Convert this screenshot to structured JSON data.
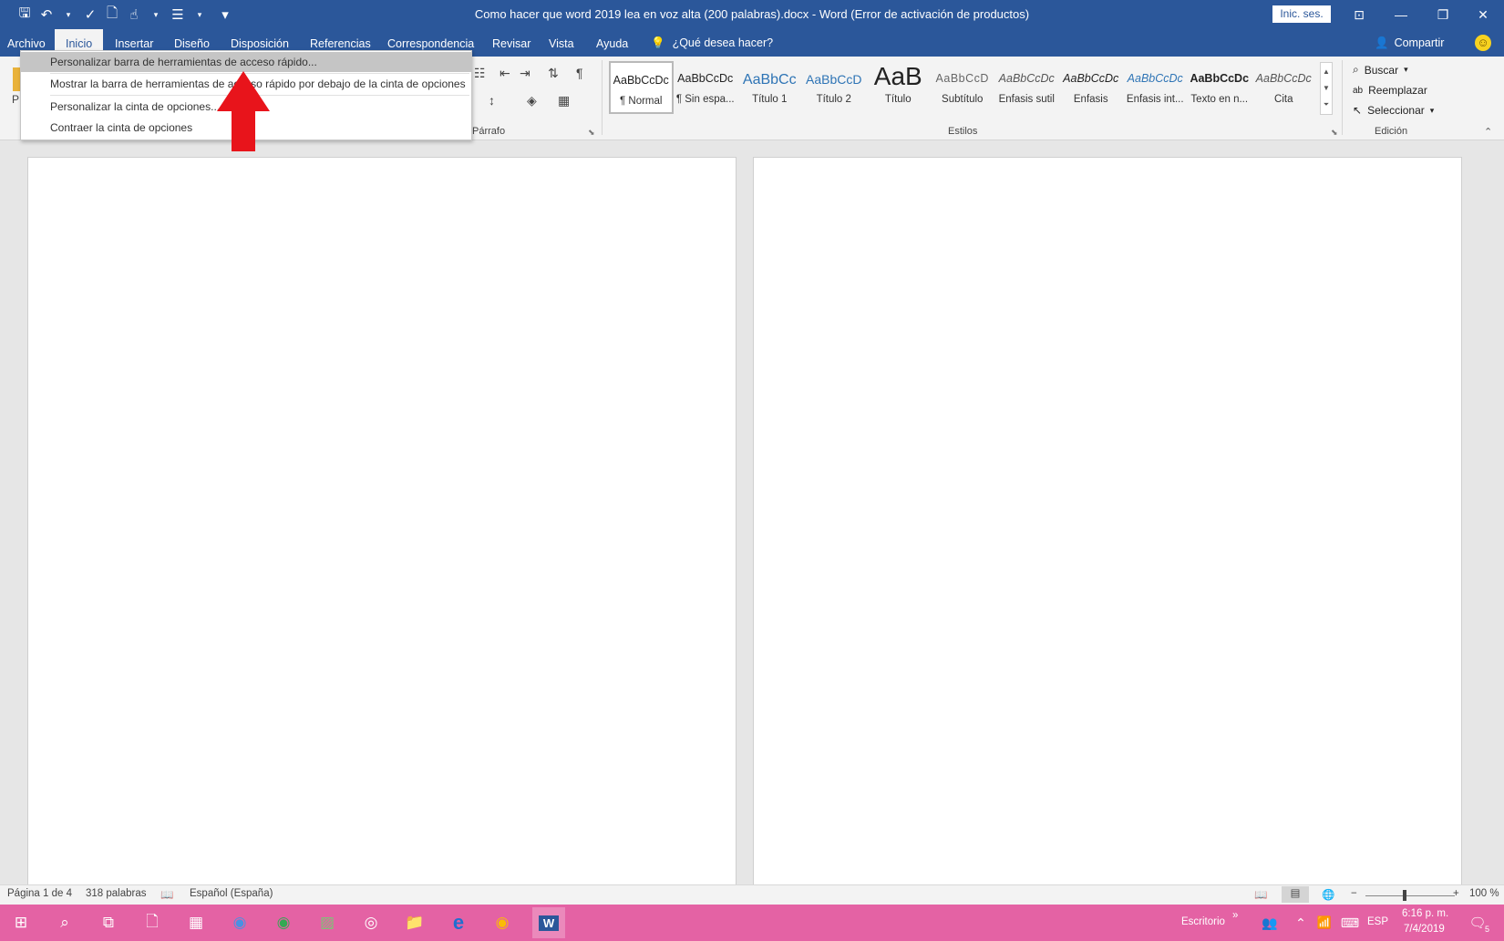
{
  "window": {
    "title": "Como hacer que word 2019 lea en voz alta (200 palabras).docx  -  Word (Error de activación de productos)",
    "signin": "Inic. ses.",
    "minimize": "—",
    "restore": "❐",
    "close": "✕",
    "ribbon_display": "⊡"
  },
  "qat": {
    "save": "🖫",
    "undo": "↶",
    "spell": "✓",
    "new": "🗋",
    "touch": "☝",
    "list": "☰",
    "more": "▾",
    "caret": "▾"
  },
  "tabs": [
    "Archivo",
    "Inicio",
    "Insertar",
    "Diseño",
    "Disposición",
    "Referencias",
    "Correspondencia",
    "Revisar",
    "Vista",
    "Ayuda"
  ],
  "tellme": {
    "label": "¿Qué desea hacer?",
    "icon": "💡"
  },
  "share": {
    "label": "Compartir",
    "icon": "👤"
  },
  "smiley": "☺",
  "context_menu": {
    "items": [
      "Personalizar barra de herramientas de acceso rápido...",
      "Mostrar la barra de herramientas de acceso rápido por debajo de la cinta de opciones",
      "Personalizar la cinta de opciones...",
      "Contraer la cinta de opciones"
    ]
  },
  "ribbon": {
    "clipboard_partial": "P",
    "paragraph_label": "Párrafo",
    "styles_label": "Estilos",
    "editing_label": "Edición",
    "paragraph_icons": {
      "list": "☷",
      "decrease_indent": "⇤",
      "increase_indent": "⇥",
      "sort": "⇅",
      "pilcrow": "¶",
      "line_spacing": "↕",
      "shading": "◈",
      "borders": "▦"
    },
    "styles": [
      {
        "sample": "AaBbCcDc",
        "name": "¶ Normal"
      },
      {
        "sample": "AaBbCcDc",
        "name": "¶ Sin espa..."
      },
      {
        "sample": "AaBbCc",
        "name": "Título 1"
      },
      {
        "sample": "AaBbCcD",
        "name": "Título 2"
      },
      {
        "sample": "AaB",
        "name": "Título"
      },
      {
        "sample": "AaBbCcD",
        "name": "Subtítulo"
      },
      {
        "sample": "AaBbCcDc",
        "name": "Énfasis sutil"
      },
      {
        "sample": "AaBbCcDc",
        "name": "Énfasis"
      },
      {
        "sample": "AaBbCcDc",
        "name": "Énfasis int..."
      },
      {
        "sample": "AaBbCcDc",
        "name": "Texto en n..."
      },
      {
        "sample": "AaBbCcDc",
        "name": "Cita"
      }
    ],
    "styles_scroll": {
      "up": "▲",
      "down": "▼",
      "more": "⏷"
    },
    "editing": {
      "find": "Buscar",
      "replace": "Reemplazar",
      "select": "Seleccionar",
      "find_icon": "⌕",
      "replace_icon": "ab",
      "select_icon": "↖"
    },
    "collapse": "⌃",
    "launcher": "⬊"
  },
  "status": {
    "page": "Página 1 de 4",
    "words": "318 palabras",
    "language": "Español (España)",
    "zoom": "100 %",
    "zoom_minus": "−",
    "zoom_plus": "+",
    "proof_icon": "📖",
    "read_mode_icon": "📖",
    "print_layout_icon": "▤",
    "web_layout_icon": "🌐"
  },
  "taskbar": {
    "desktop_label": "Escritorio",
    "chevron": "»",
    "language": "ESP",
    "time": "6:16 p. m.",
    "date": "7/4/2019",
    "notification_count": "5",
    "icons": {
      "start": "⊞",
      "search": "⌕",
      "task_view": "⧉",
      "file": "🗋",
      "calculator": "▦",
      "chrome": "◉",
      "chrome2": "◉",
      "photos": "▨",
      "groove": "◎",
      "explorer": "📁",
      "edge": "e",
      "chrome3": "◉",
      "word": "W",
      "people": "👥",
      "up": "⌃",
      "wifi": "📶",
      "keyboard": "⌨",
      "notifications": "🗨"
    }
  },
  "colors": {
    "titlebar": "#2b579a",
    "taskbar": "#e462a4",
    "arrow": "#e8141b"
  }
}
